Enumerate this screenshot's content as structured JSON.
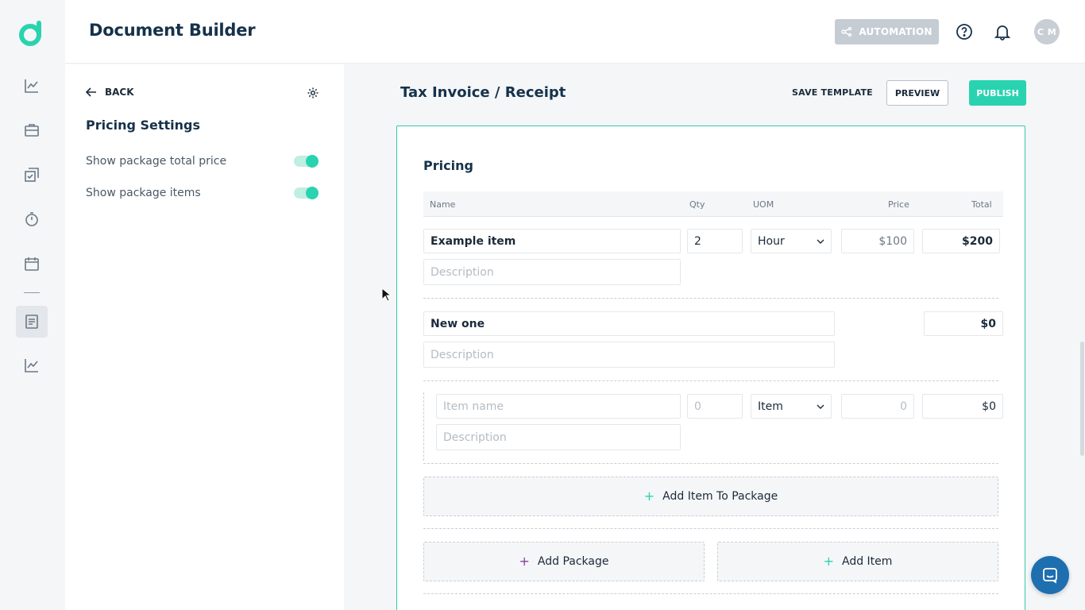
{
  "header": {
    "title": "Document Builder",
    "automation_label": "AUTOMATION",
    "avatar_initials": "C M"
  },
  "sidebar": {
    "items": [
      {
        "icon": "chart-line-icon"
      },
      {
        "icon": "briefcase-icon"
      },
      {
        "icon": "checklist-copy-icon"
      },
      {
        "icon": "stopwatch-icon"
      },
      {
        "icon": "calendar-icon"
      },
      {
        "icon": "document-icon",
        "active": true
      },
      {
        "icon": "chart-line-icon"
      }
    ]
  },
  "settings_panel": {
    "back_label": "BACK",
    "title": "Pricing Settings",
    "toggles": [
      {
        "label": "Show package total price",
        "on": true
      },
      {
        "label": "Show package items",
        "on": true
      }
    ]
  },
  "document": {
    "title": "Tax Invoice / Receipt",
    "save_template_label": "SAVE TEMPLATE",
    "preview_label": "PREVIEW",
    "publish_label": "PUBLISH"
  },
  "pricing": {
    "section_title": "Pricing",
    "columns": {
      "name": "Name",
      "qty": "Qty",
      "uom": "UOM",
      "price": "Price",
      "total": "Total"
    },
    "row1": {
      "name": "Example item",
      "qty": "2",
      "uom": "Hour",
      "price": "$100",
      "total": "$200",
      "description_placeholder": "Description"
    },
    "package": {
      "name": "New one",
      "total": "$0",
      "description_placeholder": "Description"
    },
    "package_item": {
      "name_placeholder": "Item name",
      "qty_placeholder": "0",
      "uom": "Item",
      "price_placeholder": "0",
      "total": "$0",
      "description_placeholder": "Description"
    },
    "add_item_to_package_label": "Add Item To Package",
    "add_package_label": "Add Package",
    "add_item_label": "Add Item"
  },
  "colors": {
    "accent": "#29d3b0",
    "primary_text": "#16324a",
    "chat_button": "#1e6fb0",
    "add_package_plus": "#8b3fa0"
  }
}
